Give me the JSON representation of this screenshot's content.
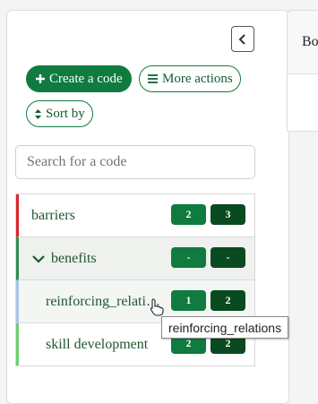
{
  "toolbar": {
    "create_label": "Create a code",
    "more_actions_label": "More actions",
    "sort_label": "Sort by"
  },
  "search": {
    "placeholder": "Search for a code",
    "value": ""
  },
  "codes": [
    {
      "label": "barriers",
      "count_a": "2",
      "count_b": "3",
      "color": "#d9262c"
    },
    {
      "label": "benefits",
      "count_a": "-",
      "count_b": "-",
      "color": "#2e8b57",
      "expanded": true
    },
    {
      "label": "reinforcing_relati…",
      "count_a": "1",
      "count_b": "2",
      "color": "#a9c4e8"
    },
    {
      "label": "skill development",
      "count_a": "2",
      "count_b": "2",
      "color": "#6fcf6f"
    }
  ],
  "tooltip": {
    "text": "reinforcing_relations"
  },
  "right_panel": {
    "header_text": "Bo"
  },
  "colors": {
    "primary": "#0f7b3f",
    "dark_badge": "#0a4a21"
  },
  "icons": [
    "chevron-left-icon",
    "plus-icon",
    "list-icon",
    "sort-icon",
    "chevron-down-icon",
    "pointer-cursor-icon"
  ]
}
